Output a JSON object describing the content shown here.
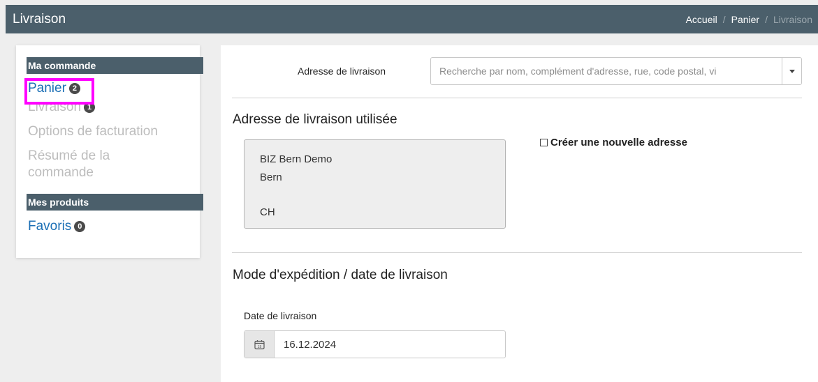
{
  "header": {
    "title": "Livraison",
    "breadcrumb": [
      "Accueil",
      "Panier",
      "Livraison"
    ],
    "separator": "/"
  },
  "sidebar": {
    "section1_title": "Ma commande",
    "items": [
      {
        "label": "Panier",
        "badge": "2"
      },
      {
        "label": "Livraison",
        "badge": "1"
      },
      {
        "label": "Options de facturation"
      },
      {
        "label": "Résumé de la"
      },
      {
        "label": "commande"
      }
    ],
    "section2_title": "Mes produits",
    "products": [
      {
        "label": "Favoris",
        "badge": "0"
      }
    ]
  },
  "main": {
    "address_label": "Adresse de livraison",
    "address_search_placeholder": "Recherche par nom, complément d'adresse, rue, code postal, vi",
    "used_address_heading": "Adresse de livraison utilisée",
    "address_lines": [
      "BIZ Bern Demo",
      "Bern",
      "CH"
    ],
    "new_address_label": "Créer une nouvelle adresse",
    "shipping_heading": "Mode d'expédition / date de livraison",
    "date_label": "Date de livraison",
    "date_value": "16.12.2024",
    "calendar_icon_text": "19"
  },
  "colors": {
    "header_bg": "#4b5f6b",
    "link": "#1b6fb5",
    "highlight": "#ff00ff"
  }
}
